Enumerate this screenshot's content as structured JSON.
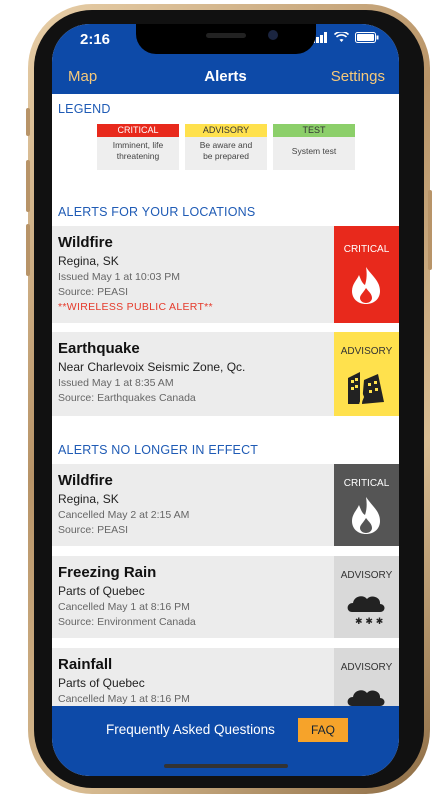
{
  "status": {
    "time": "2:16"
  },
  "nav": {
    "left": "Map",
    "title": "Alerts",
    "right": "Settings"
  },
  "legend": {
    "title": "LEGEND",
    "items": [
      {
        "tag": "CRITICAL",
        "desc1": "Imminent, life",
        "desc2": "threatening",
        "color": "#e8291c"
      },
      {
        "tag": "ADVISORY",
        "desc1": "Be aware and",
        "desc2": "be prepared",
        "color": "#ffe14d"
      },
      {
        "tag": "TEST",
        "desc1": "System test",
        "desc2": "",
        "color": "#8ccf6a"
      }
    ]
  },
  "active": {
    "title": "ALERTS FOR YOUR LOCATIONS",
    "alerts": [
      {
        "title": "Wildfire",
        "location": "Regina, SK",
        "issued": "Issued May 1 at 10:03 PM",
        "source": "Source: PEASI",
        "note": "**WIRELESS PUBLIC ALERT**",
        "badge": "CRITICAL"
      },
      {
        "title": "Earthquake",
        "location": "Near Charlevoix Seismic Zone, Qc.",
        "issued": "Issued May 1 at 8:35 AM",
        "source": "Source: Earthquakes Canada",
        "badge": "ADVISORY"
      }
    ]
  },
  "inactive": {
    "title": "ALERTS NO LONGER IN EFFECT",
    "alerts": [
      {
        "title": "Wildfire",
        "location": "Regina, SK",
        "issued": "Cancelled May 2 at 2:15 AM",
        "source": "Source: PEASI",
        "badge": "CRITICAL"
      },
      {
        "title": "Freezing Rain",
        "location": "Parts of Quebec",
        "issued": "Cancelled May 1 at 8:16 PM",
        "source": "Source: Environment Canada",
        "badge": "ADVISORY"
      },
      {
        "title": "Rainfall",
        "location": "Parts of Quebec",
        "issued": "Cancelled May 1 at 8:16 PM",
        "badge": "ADVISORY"
      }
    ]
  },
  "footer": {
    "text": "Frequently Asked Questions",
    "button": "FAQ"
  },
  "colors": {
    "brand": "#0d4aa8",
    "critical": "#e8291c",
    "advisory": "#ffe14d",
    "inactive_critical": "#555555",
    "inactive_advisory": "#d9d9d9"
  }
}
